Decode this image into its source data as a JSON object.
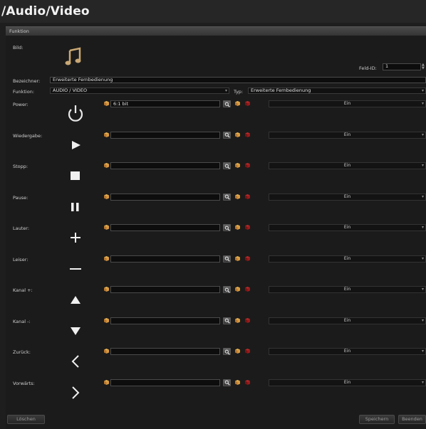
{
  "window": {
    "title": "/Audio/Video"
  },
  "section": {
    "label": "Funktion"
  },
  "form": {
    "bild_label": "Bild:",
    "feld_id_label": "Feld-ID:",
    "feld_id_value": "1",
    "bezeichner_label": "Bezeichner:",
    "bezeichner_value": "Erweiterte Fernbedienung",
    "funktion_label": "Funktion:",
    "funktion_value": "AUDIO / VIDEO",
    "typ_label": "Typ:",
    "typ_value": "Erweiterte Fernbedienung"
  },
  "rows": [
    {
      "label": "Power:",
      "icon": "power-icon",
      "address": "6:1 bit",
      "state": "Ein"
    },
    {
      "label": "Wiedergabe:",
      "icon": "play-icon",
      "address": "",
      "state": "Ein"
    },
    {
      "label": "Stopp:",
      "icon": "stop-icon",
      "address": "",
      "state": "Ein"
    },
    {
      "label": "Pause:",
      "icon": "pause-icon",
      "address": "",
      "state": "Ein"
    },
    {
      "label": "Lauter:",
      "icon": "plus-icon",
      "address": "",
      "state": "Ein"
    },
    {
      "label": "Leiser:",
      "icon": "minus-icon",
      "address": "",
      "state": "Ein"
    },
    {
      "label": "Kanal +:",
      "icon": "triangle-up-icon",
      "address": "",
      "state": "Ein"
    },
    {
      "label": "Kanal -:",
      "icon": "triangle-down-icon",
      "address": "",
      "state": "Ein"
    },
    {
      "label": "Zurück:",
      "icon": "chevron-left-icon",
      "address": "",
      "state": "Ein"
    },
    {
      "label": "Vorwärts:",
      "icon": "chevron-right-icon",
      "address": "",
      "state": "Ein"
    }
  ],
  "buttons": {
    "delete": "Löschen",
    "save": "Speichern",
    "close": "Beenden"
  },
  "colors": {
    "accent": "#c89040",
    "remove": "#c02020"
  }
}
